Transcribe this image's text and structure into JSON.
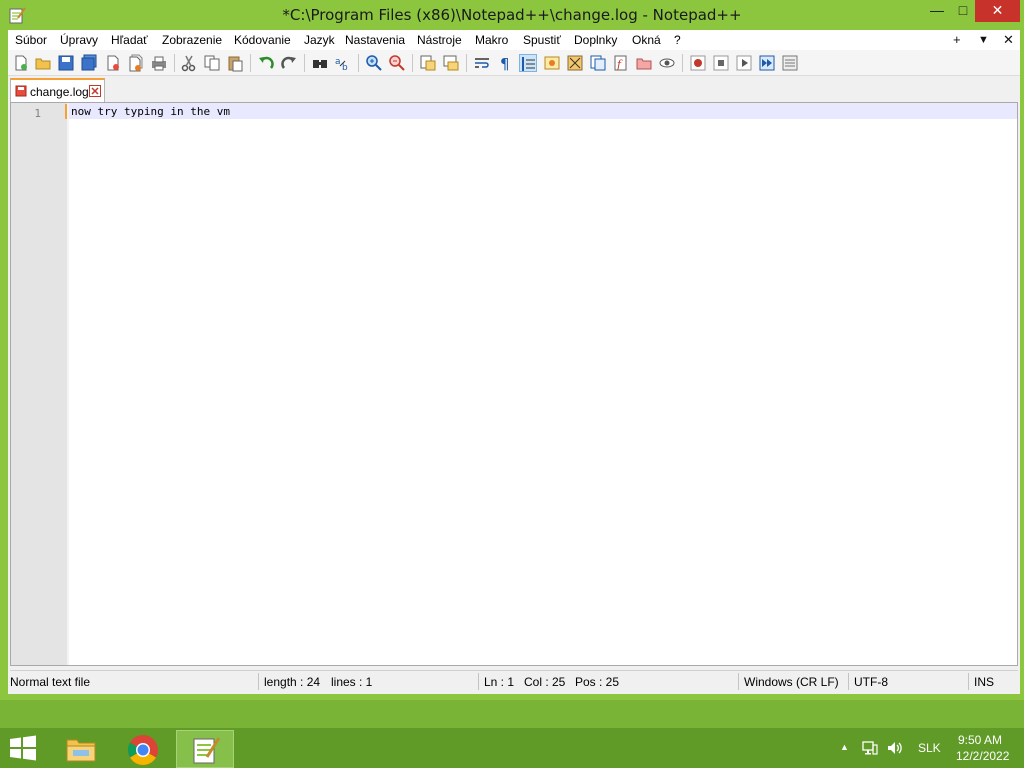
{
  "window": {
    "title": "*C:\\Program Files (x86)\\Notepad++\\change.log - Notepad++",
    "min_icon": "minimize-icon",
    "max_icon": "maximize-icon",
    "close_icon": "close-icon"
  },
  "menu": {
    "items": [
      "Súbor",
      "Úpravy",
      "Hľadať",
      "Zobrazenie",
      "Kódovanie",
      "Jazyk",
      "Nastavenia",
      "Nástroje",
      "Makro",
      "Spustiť",
      "Doplnky",
      "Okná",
      "?"
    ],
    "right_plus": "+",
    "right_down": "▼",
    "right_close": "✕"
  },
  "toolbar": {
    "buttons": [
      "new-file",
      "open-file",
      "save",
      "save-all",
      "close",
      "close-all",
      "print",
      "cut",
      "copy",
      "paste",
      "undo",
      "redo",
      "find",
      "replace",
      "zoom-in",
      "zoom-out",
      "sync-vertical",
      "sync-horizontal",
      "word-wrap",
      "show-all-chars",
      "indent-guide",
      "user-lang",
      "doc-map",
      "function-list",
      "folder-workspace",
      "monitoring",
      "eye",
      "record-macro",
      "stop-macro",
      "play-macro",
      "run-macro-multiple",
      "save-macro"
    ],
    "active": "indent-guide"
  },
  "tabs": [
    {
      "label": "change.log",
      "icon": "unsaved-file-icon",
      "close_icon": "tab-close-icon"
    }
  ],
  "editor": {
    "lines": [
      {
        "number": "1",
        "text": "now try typing in the vm"
      }
    ]
  },
  "status": {
    "file_type": "Normal text file",
    "length": "length : 24",
    "lines": "lines : 1",
    "ln": "Ln : 1",
    "col": "Col : 25",
    "pos": "Pos : 25",
    "eol": "Windows (CR LF)",
    "encoding": "UTF-8",
    "mode": "INS"
  },
  "taskbar": {
    "apps": [
      {
        "name": "file-explorer"
      },
      {
        "name": "chrome"
      },
      {
        "name": "notepad-plus-plus",
        "active": true
      }
    ],
    "tray": {
      "expand": "▲",
      "network_icon": "network-icon",
      "volume_icon": "volume-icon",
      "lang": "SLK",
      "time": "9:50 AM",
      "date": "12/2/2022"
    }
  },
  "colors": {
    "title_bg": "#8cc63f",
    "close_bg": "#c7332b",
    "tab_accent": "#f7a035",
    "current_line": "#e8e8ff",
    "taskbar": "#5f9b26"
  }
}
